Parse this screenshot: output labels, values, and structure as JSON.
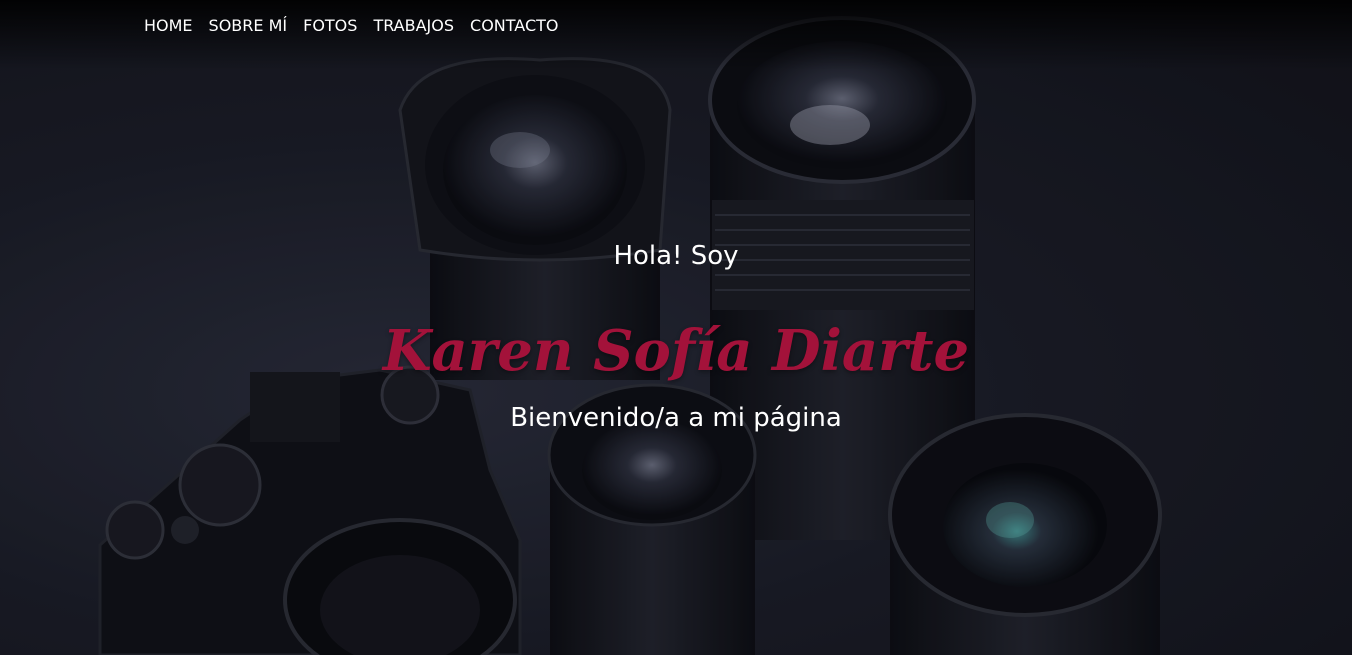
{
  "nav": {
    "items": [
      {
        "label": "HOME"
      },
      {
        "label": "SOBRE MÍ"
      },
      {
        "label": "FOTOS"
      },
      {
        "label": "TRABAJOS"
      },
      {
        "label": "CONTACTO"
      }
    ]
  },
  "hero": {
    "greeting": "Hola! Soy",
    "name": "Karen Sofía Diarte",
    "welcome": "Bienvenido/a a mi página",
    "background_image": "camera-and-lenses-photo",
    "name_color": "#a3123a"
  }
}
